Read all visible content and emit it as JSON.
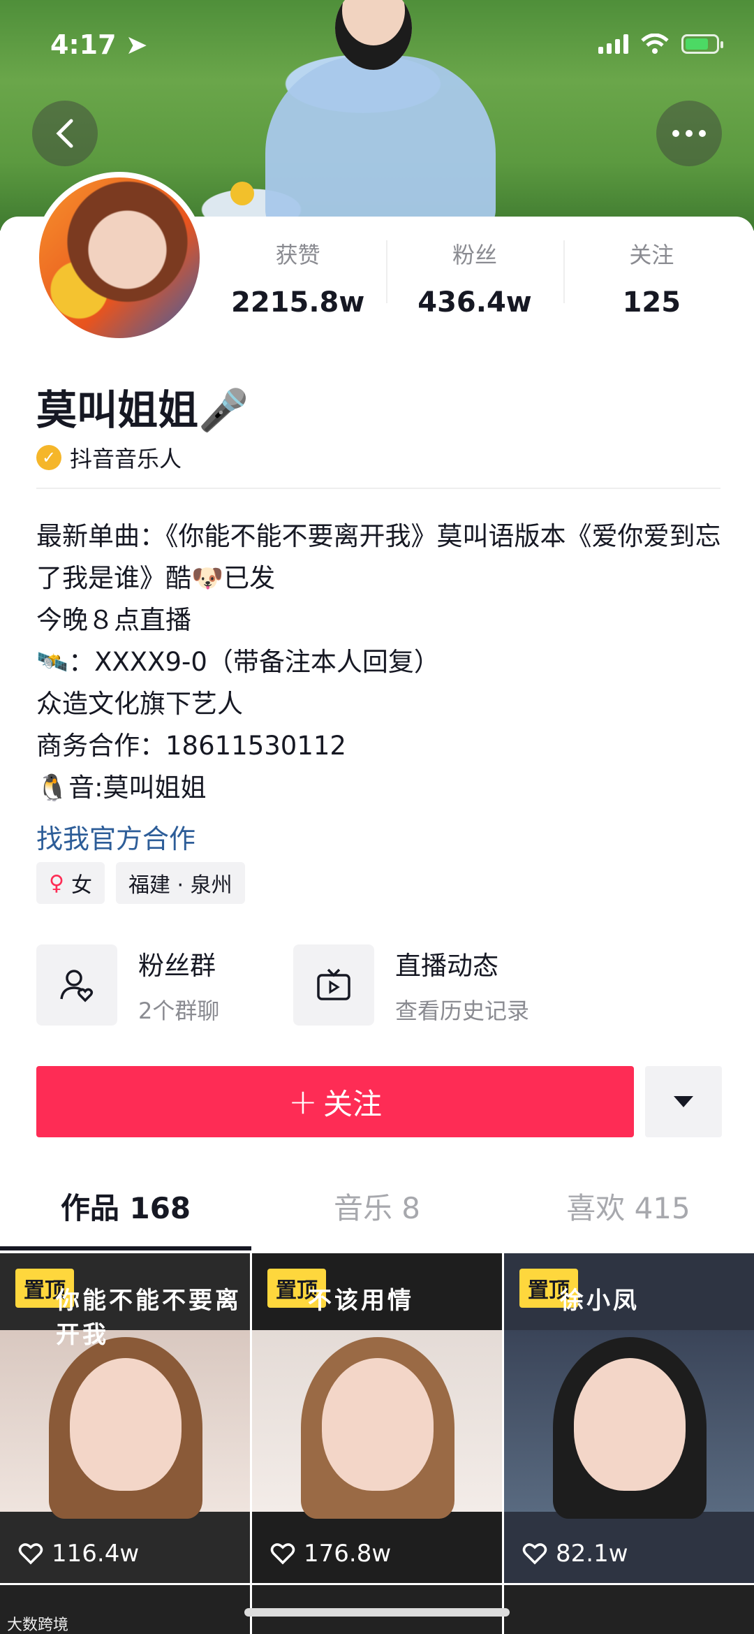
{
  "status": {
    "time": "4:17"
  },
  "nav": {
    "back_icon": "chevron-left-icon",
    "more_icon": "more-dots-icon"
  },
  "stats": [
    {
      "label": "获赞",
      "value": "2215.8w"
    },
    {
      "label": "粉丝",
      "value": "436.4w"
    },
    {
      "label": "关注",
      "value": "125"
    }
  ],
  "profile": {
    "name": "莫叫姐姐🎤",
    "verified_label": "抖音音乐人",
    "bio": [
      "最新单曲：《你能不能不要离开我》莫叫语版本《爱你爱到忘了我是谁》酷🐶已发",
      "今晚８点直播",
      "🛰️：XXXX9-0（带备注本人回复）",
      "众造文化旗下艺人",
      "商务合作：18611530112",
      "🐧音:莫叫姐姐"
    ],
    "link": "找我官方合作",
    "tags": [
      {
        "symbol": "♀",
        "label": "女"
      },
      {
        "symbol": "",
        "label": "福建 · 泉州"
      }
    ]
  },
  "quick": [
    {
      "title": "粉丝群",
      "sub": "2个群聊"
    },
    {
      "title": "直播动态",
      "sub": "查看历史记录"
    }
  ],
  "follow": {
    "label": "关注",
    "plus": "+"
  },
  "tabs": [
    {
      "label": "作品 168"
    },
    {
      "label": "音乐 8"
    },
    {
      "label": "喜欢 415"
    }
  ],
  "videos": [
    {
      "pin": "置顶",
      "caption": "你能不能不要离开我",
      "likes": "116.4w",
      "bg": "#2a2a2a"
    },
    {
      "pin": "置顶",
      "caption": "不该用情",
      "likes": "176.8w",
      "bg": "#1e1e1e"
    },
    {
      "pin": "置顶",
      "caption": "徐小凤",
      "likes": "82.1w",
      "bg": "#2e3442"
    }
  ],
  "watermark": "大数跨境",
  "colors": {
    "accent": "#fe2c55",
    "pin": "#fed73d",
    "link": "#2d5d98"
  }
}
